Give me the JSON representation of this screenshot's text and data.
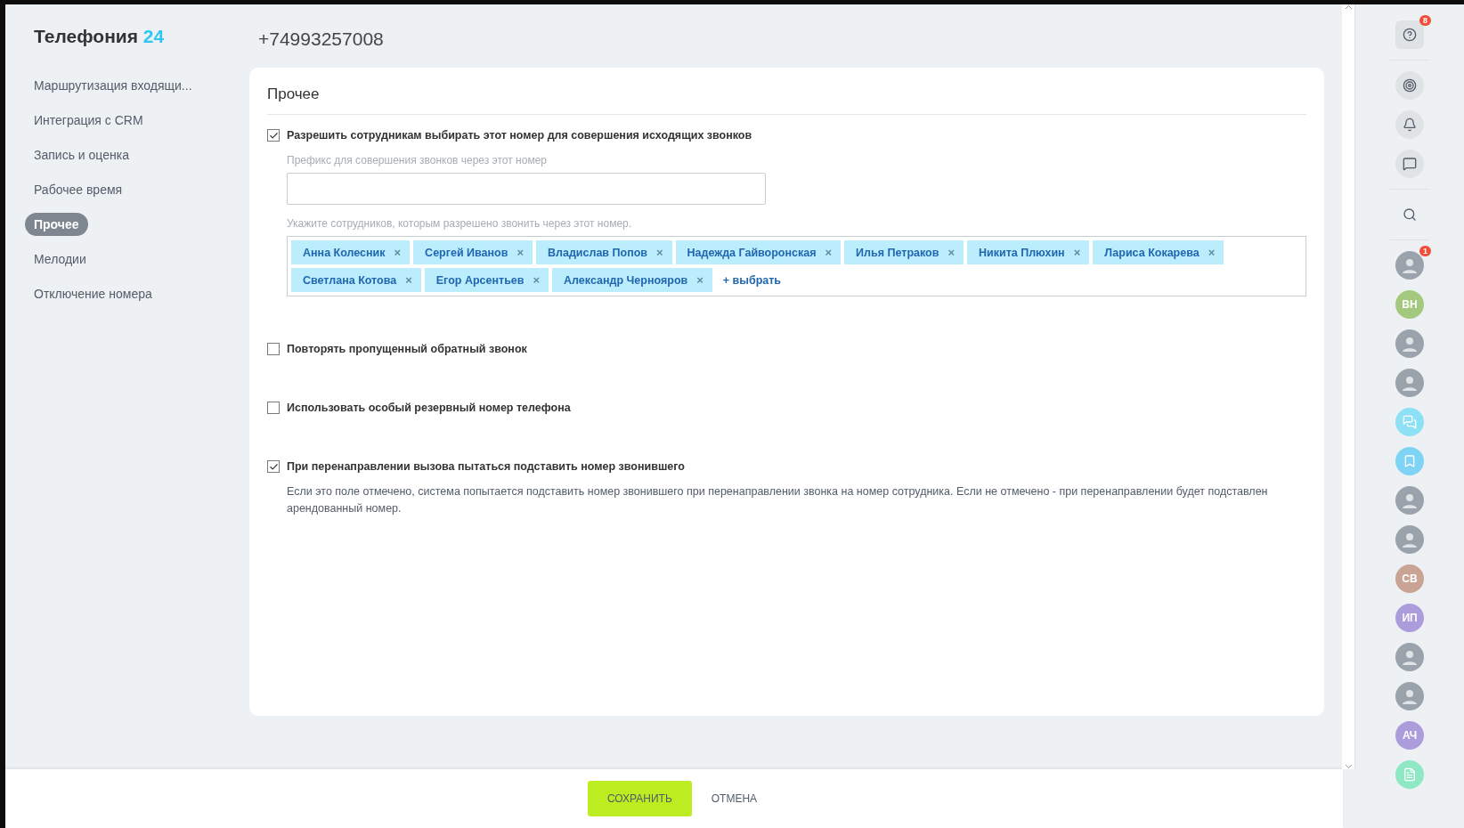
{
  "app_title": {
    "name": "Телефония",
    "suffix": "24"
  },
  "phone_number": "+74993257008",
  "sidebar": {
    "items": [
      {
        "label": "Маршрутизация входящи...",
        "selected": false
      },
      {
        "label": "Интеграция с CRM",
        "selected": false
      },
      {
        "label": "Запись и оценка",
        "selected": false
      },
      {
        "label": "Рабочее время",
        "selected": false
      },
      {
        "label": "Прочее",
        "selected": true
      },
      {
        "label": "Мелодии",
        "selected": false
      },
      {
        "label": "Отключение номера",
        "selected": false
      }
    ]
  },
  "card": {
    "title": "Прочее",
    "options": [
      {
        "kind": "users",
        "label": "Разрешить сотрудникам выбирать этот номер для совершения исходящих звонков",
        "checked": true,
        "prefix_label": "Префикс для совершения звонков через этот номер",
        "users_label": "Укажите сотрудников, которым разрешено звонить через этот номер.",
        "users": [
          "Анна Колесник",
          "Сергей Иванов",
          "Владислав Попов",
          "Надежда Гайворонская",
          "Илья Петраков",
          "Никита Плюхин",
          "Лариса Кокарева",
          "Светлана Котова",
          "Егор Арсентьев",
          "Александр Чернояров"
        ],
        "remove_mark": "×",
        "add_label": "+ выбрать"
      },
      {
        "kind": "plain",
        "label": "Повторять пропущенный обратный звонок",
        "checked": false
      },
      {
        "kind": "plain",
        "label": "Использовать особый резервный номер телефона",
        "checked": false
      },
      {
        "kind": "note",
        "label": "При перенаправлении вызова пытаться подставить номер звонившего",
        "checked": true,
        "note": "Если это поле отмечено, система попытается подставить номер звонившего при перенаправлении звонка на номер сотрудника. Если не отмечено - при перенаправлении будет подставлен арендованный номер."
      }
    ]
  },
  "footer": {
    "buttons": [
      {
        "kind": "primary",
        "label": "СОХРАНИТЬ"
      },
      {
        "kind": "link",
        "label": "ОТМЕНА"
      }
    ]
  },
  "right_panel": {
    "items": [
      {
        "kind": "help",
        "badge": "8"
      },
      {
        "kind": "divider"
      },
      {
        "kind": "target"
      },
      {
        "kind": "bell"
      },
      {
        "kind": "chat"
      },
      {
        "kind": "divider"
      },
      {
        "kind": "search"
      },
      {
        "kind": "divider"
      },
      {
        "kind": "photo",
        "badge": "1"
      },
      {
        "kind": "initials",
        "text": "ВН",
        "color": "#a4c97e"
      },
      {
        "kind": "photo"
      },
      {
        "kind": "photo"
      },
      {
        "kind": "messages"
      },
      {
        "kind": "bookmark"
      },
      {
        "kind": "photo"
      },
      {
        "kind": "photo"
      },
      {
        "kind": "initials",
        "text": "СВ",
        "color": "#c9a393"
      },
      {
        "kind": "initials",
        "text": "ИП",
        "color": "#ab9ddb"
      },
      {
        "kind": "photo"
      },
      {
        "kind": "photo"
      },
      {
        "kind": "initials",
        "text": "АЧ",
        "color": "#ab9ddb"
      },
      {
        "kind": "notes"
      }
    ]
  }
}
